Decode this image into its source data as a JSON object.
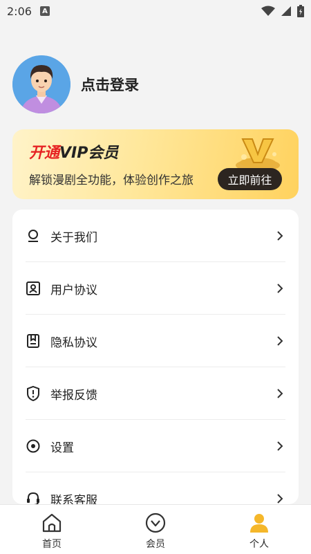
{
  "status_bar": {
    "time": "2:06",
    "notif_letter": "A"
  },
  "profile": {
    "login_label": "点击登录"
  },
  "vip": {
    "title_red": "开通",
    "title_dark": "VIP会员",
    "subtitle": "解锁漫剧全功能，体验创作之旅",
    "button": "立即前往"
  },
  "menu": {
    "items": [
      {
        "label": "关于我们",
        "icon": "about-icon"
      },
      {
        "label": "用户协议",
        "icon": "user-agreement-icon"
      },
      {
        "label": "隐私协议",
        "icon": "privacy-icon"
      },
      {
        "label": "举报反馈",
        "icon": "report-icon"
      },
      {
        "label": "设置",
        "icon": "settings-icon"
      },
      {
        "label": "联系客服",
        "icon": "headset-icon"
      }
    ]
  },
  "tabbar": {
    "tabs": [
      {
        "label": "首页",
        "icon": "home-icon"
      },
      {
        "label": "会员",
        "icon": "vip-icon"
      },
      {
        "label": "个人",
        "icon": "person-icon",
        "active": true
      }
    ]
  },
  "colors": {
    "accent": "#f5b72a",
    "vip_red": "#e62323",
    "button_dark": "#2c2520"
  }
}
